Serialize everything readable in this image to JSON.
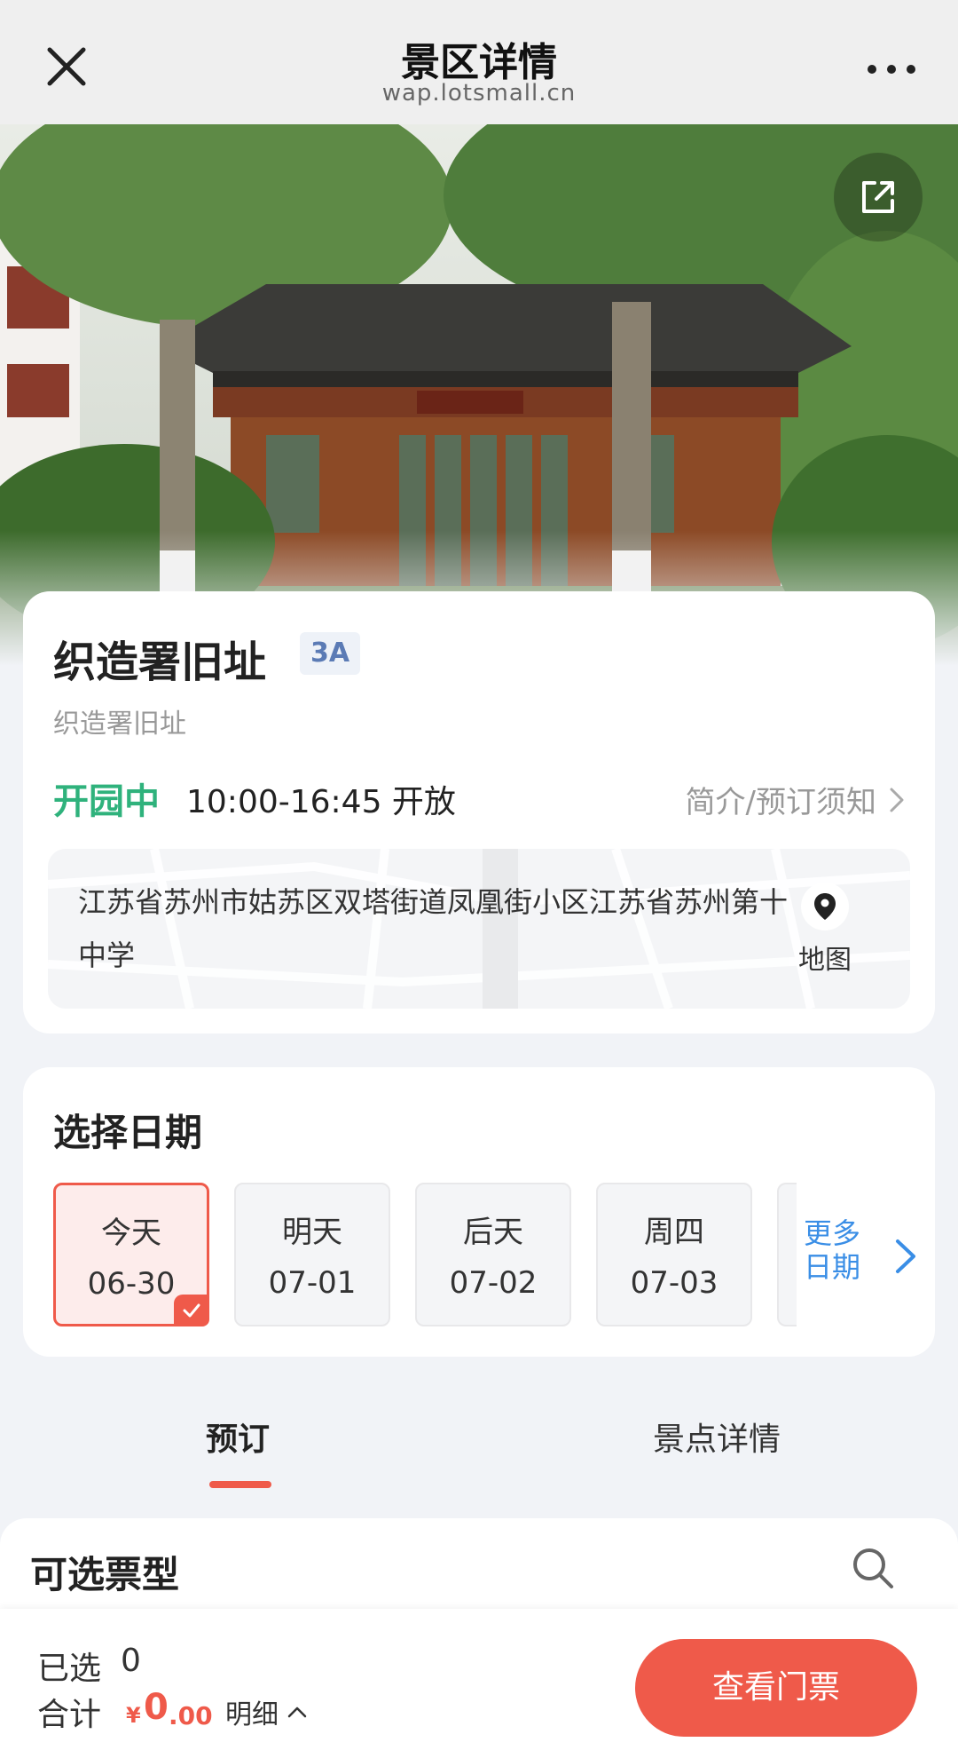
{
  "nav": {
    "title": "景区详情",
    "url": "wap.lotsmall.cn"
  },
  "spot": {
    "name": "织造署旧址",
    "level": "3A",
    "subtitle": "织造署旧址",
    "status": "开园中",
    "hours": "10:00-16:45 开放",
    "intro_link": "简介/预订须知",
    "address": "江苏省苏州市姑苏区双塔街道凤凰街小区江苏省苏州第十中学",
    "map_label": "地图"
  },
  "date_picker": {
    "title": "选择日期",
    "dates": [
      {
        "label": "今天",
        "date": "06-30",
        "selected": true
      },
      {
        "label": "明天",
        "date": "07-01",
        "selected": false
      },
      {
        "label": "后天",
        "date": "07-02",
        "selected": false
      },
      {
        "label": "周四",
        "date": "07-03",
        "selected": false
      }
    ],
    "more_line1": "更多",
    "more_line2": "日期"
  },
  "tabs": {
    "book": "预订",
    "detail": "景点详情"
  },
  "tickets": {
    "title": "可选票型"
  },
  "bottom": {
    "selected_label": "已选",
    "selected_count": "0",
    "total_label": "合计",
    "currency": "¥",
    "price_int": "0",
    "price_dec": ".00",
    "detail_label": "明细",
    "cta": "查看门票"
  },
  "colors": {
    "accent": "#ef5a4a",
    "open_green": "#2fb27c",
    "link_blue": "#3a8ee6",
    "level_blue": "#5b7bb5"
  }
}
